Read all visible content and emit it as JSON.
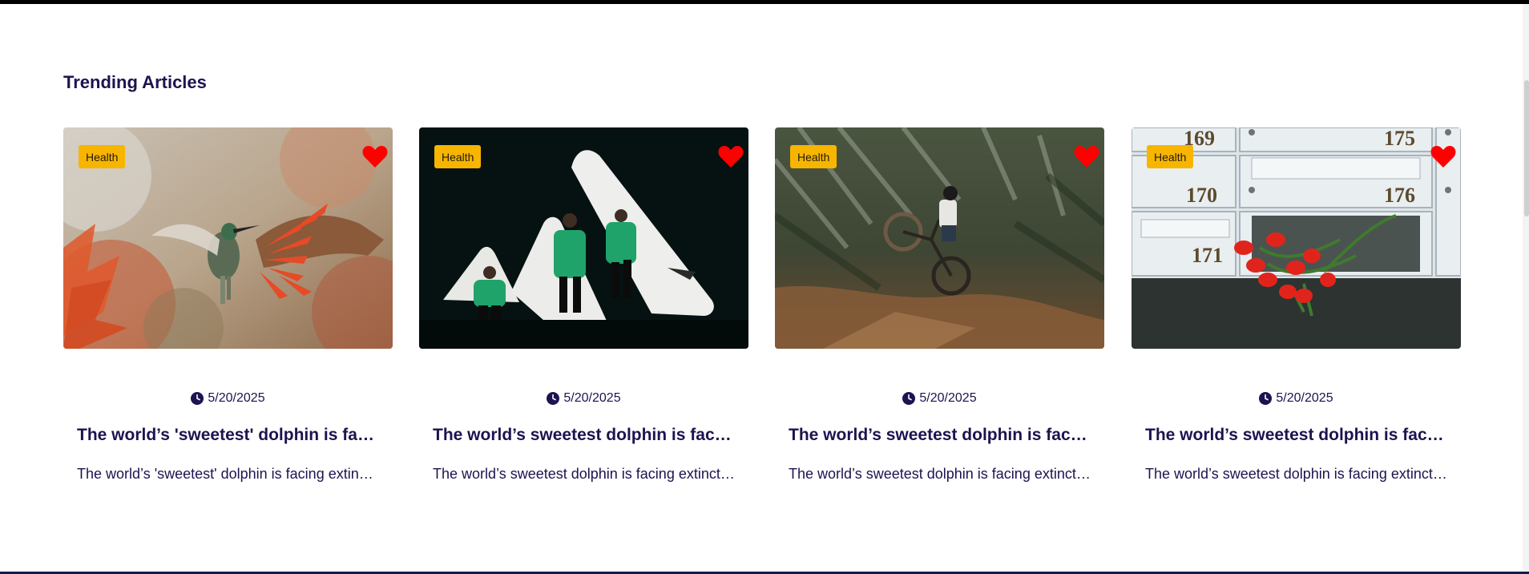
{
  "section": {
    "title": "Trending Articles"
  },
  "cards": [
    {
      "category": "Health",
      "date": "5/20/2025",
      "title": "The world’s 'sweetest' dolphin is facing extinction",
      "excerpt": "The world’s 'sweetest' dolphin is facing extinction",
      "image": "hummingbird-photo",
      "favorite_icon": "heart-icon"
    },
    {
      "category": "Health",
      "date": "5/20/2025",
      "title": "The world’s sweetest dolphin is facing extinction",
      "excerpt": "The world’s sweetest dolphin is facing extinction",
      "image": "green-jackets-photo",
      "favorite_icon": "heart-icon"
    },
    {
      "category": "Health",
      "date": "5/20/2025",
      "title": "The world’s sweetest dolphin is facing extinction",
      "excerpt": "The world’s sweetest dolphin is facing extinction",
      "image": "bmx-rider-photo",
      "favorite_icon": "heart-icon"
    },
    {
      "category": "Health",
      "date": "5/20/2025",
      "title": "The world’s sweetest dolphin is facing extinction",
      "excerpt": "The world’s sweetest dolphin is facing extinction",
      "image": "mailbox-tulips-photo",
      "favorite_icon": "heart-icon",
      "photo_text": [
        "169",
        "175",
        "170",
        "176",
        "171"
      ]
    }
  ],
  "colors": {
    "badge": "#f7b500",
    "heart": "#ff0000",
    "text": "#1b1450"
  }
}
